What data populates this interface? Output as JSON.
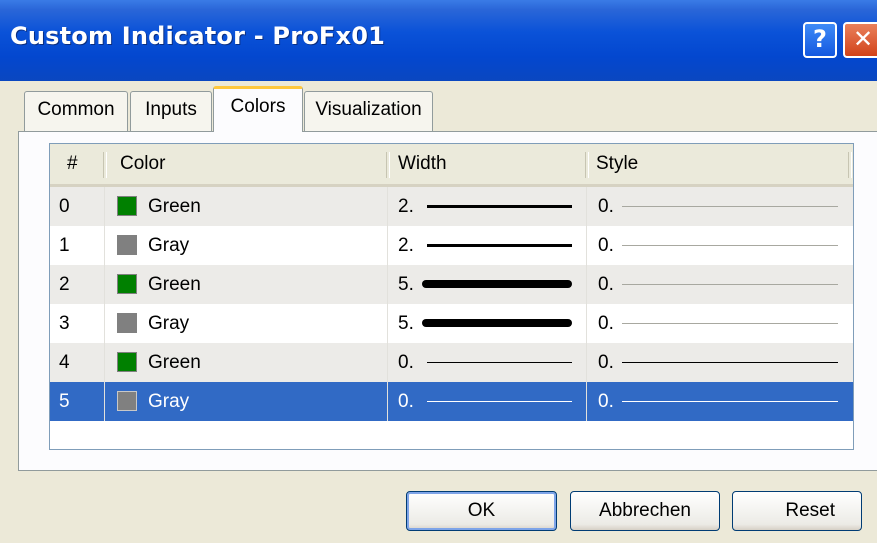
{
  "window": {
    "title": "Custom Indicator - ProFx01"
  },
  "titlebar": {
    "help_label": "?",
    "close_label": "✕"
  },
  "tabs": [
    {
      "label": "Common",
      "active": false
    },
    {
      "label": "Inputs",
      "active": false
    },
    {
      "label": "Colors",
      "active": true
    },
    {
      "label": "Visualization",
      "active": false
    }
  ],
  "table": {
    "headers": {
      "index": "#",
      "color": "Color",
      "width": "Width",
      "style": "Style"
    },
    "rows": [
      {
        "index": "0",
        "color_name": "Green",
        "color_hex": "#008000",
        "width_label": "2.",
        "width_value": 2,
        "style_label": "0.",
        "style_value": 0,
        "selected": false
      },
      {
        "index": "1",
        "color_name": "Gray",
        "color_hex": "#808080",
        "width_label": "2.",
        "width_value": 2,
        "style_label": "0.",
        "style_value": 0,
        "selected": false
      },
      {
        "index": "2",
        "color_name": "Green",
        "color_hex": "#008000",
        "width_label": "5.",
        "width_value": 5,
        "style_label": "0.",
        "style_value": 0,
        "selected": false
      },
      {
        "index": "3",
        "color_name": "Gray",
        "color_hex": "#808080",
        "width_label": "5.",
        "width_value": 5,
        "style_label": "0.",
        "style_value": 0,
        "selected": false
      },
      {
        "index": "4",
        "color_name": "Green",
        "color_hex": "#008000",
        "width_label": "0.",
        "width_value": 0,
        "style_label": "0.",
        "style_value": 0,
        "selected": false
      },
      {
        "index": "5",
        "color_name": "Gray",
        "color_hex": "#808080",
        "width_label": "0.",
        "width_value": 0,
        "style_label": "0.",
        "style_value": 0,
        "selected": true
      }
    ]
  },
  "buttons": {
    "ok": "OK",
    "cancel": "Abbrechen",
    "reset": "Reset"
  },
  "colors": {
    "selection": "#316ac5",
    "titlebar": "#0a52d8",
    "tab_highlight": "#ffc83c"
  }
}
